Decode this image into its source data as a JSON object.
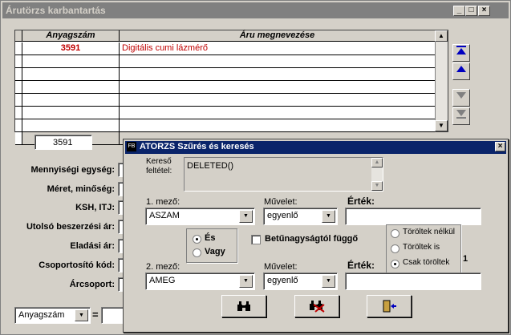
{
  "window": {
    "title": "Árutörzs karbantartás",
    "min_glyph": "_",
    "max_glyph": "□",
    "close_glyph": "×"
  },
  "grid": {
    "columns": [
      "Anyagszám",
      "Áru megnevezése"
    ],
    "rows": [
      {
        "code": "3591",
        "name": "Digitális cumi lázmérő"
      }
    ]
  },
  "selected_code": "3591",
  "fields": [
    "Mennyiségi egység:",
    "Méret, minőség:",
    "KSH, ITJ:",
    "Utolsó beszerzési ár:",
    "Eladási ár:",
    "Csoportosító kód:",
    "Árcsoport:"
  ],
  "bottom": {
    "sort_value": "Anyagszám",
    "equals": "="
  },
  "dialog": {
    "title": "ATORZS Szűrés és keresés",
    "icon_text": "FB",
    "close_glyph": "×",
    "filter_label_1": "Kereső",
    "filter_label_2": "feltétel:",
    "filter_value": "DELETED()",
    "field1_label": "1. mező:",
    "field1_value": "ASZAM",
    "op1_label": "Művelet:",
    "op1_value": "egyenlő",
    "value1_label": "Érték:",
    "value1": "",
    "and_label": "És",
    "or_label": "Vagy",
    "case_label": "Betűnagyságtól függő",
    "deleted_options": [
      "Töröltek nélkül",
      "Töröltek is",
      "Csak töröltek"
    ],
    "deleted_selected": 2,
    "field2_label": "2. mező:",
    "field2_value": "AMEG",
    "op2_label": "Művelet:",
    "op2_value": "egyenlő",
    "value2_label": "Érték:",
    "value2": "",
    "side_number": "1"
  },
  "icons": {
    "nav": [
      "first-record-icon",
      "previous-record-icon",
      "next-record-icon",
      "last-record-icon"
    ],
    "dialog_buttons": [
      "binoculars-icon",
      "binoculars-clear-icon",
      "exit-door-icon"
    ]
  },
  "colors": {
    "title_inactive": "#808080",
    "title_active": "#0a246a",
    "record_text": "#c00000",
    "nav_arrow": "#0000c0"
  }
}
